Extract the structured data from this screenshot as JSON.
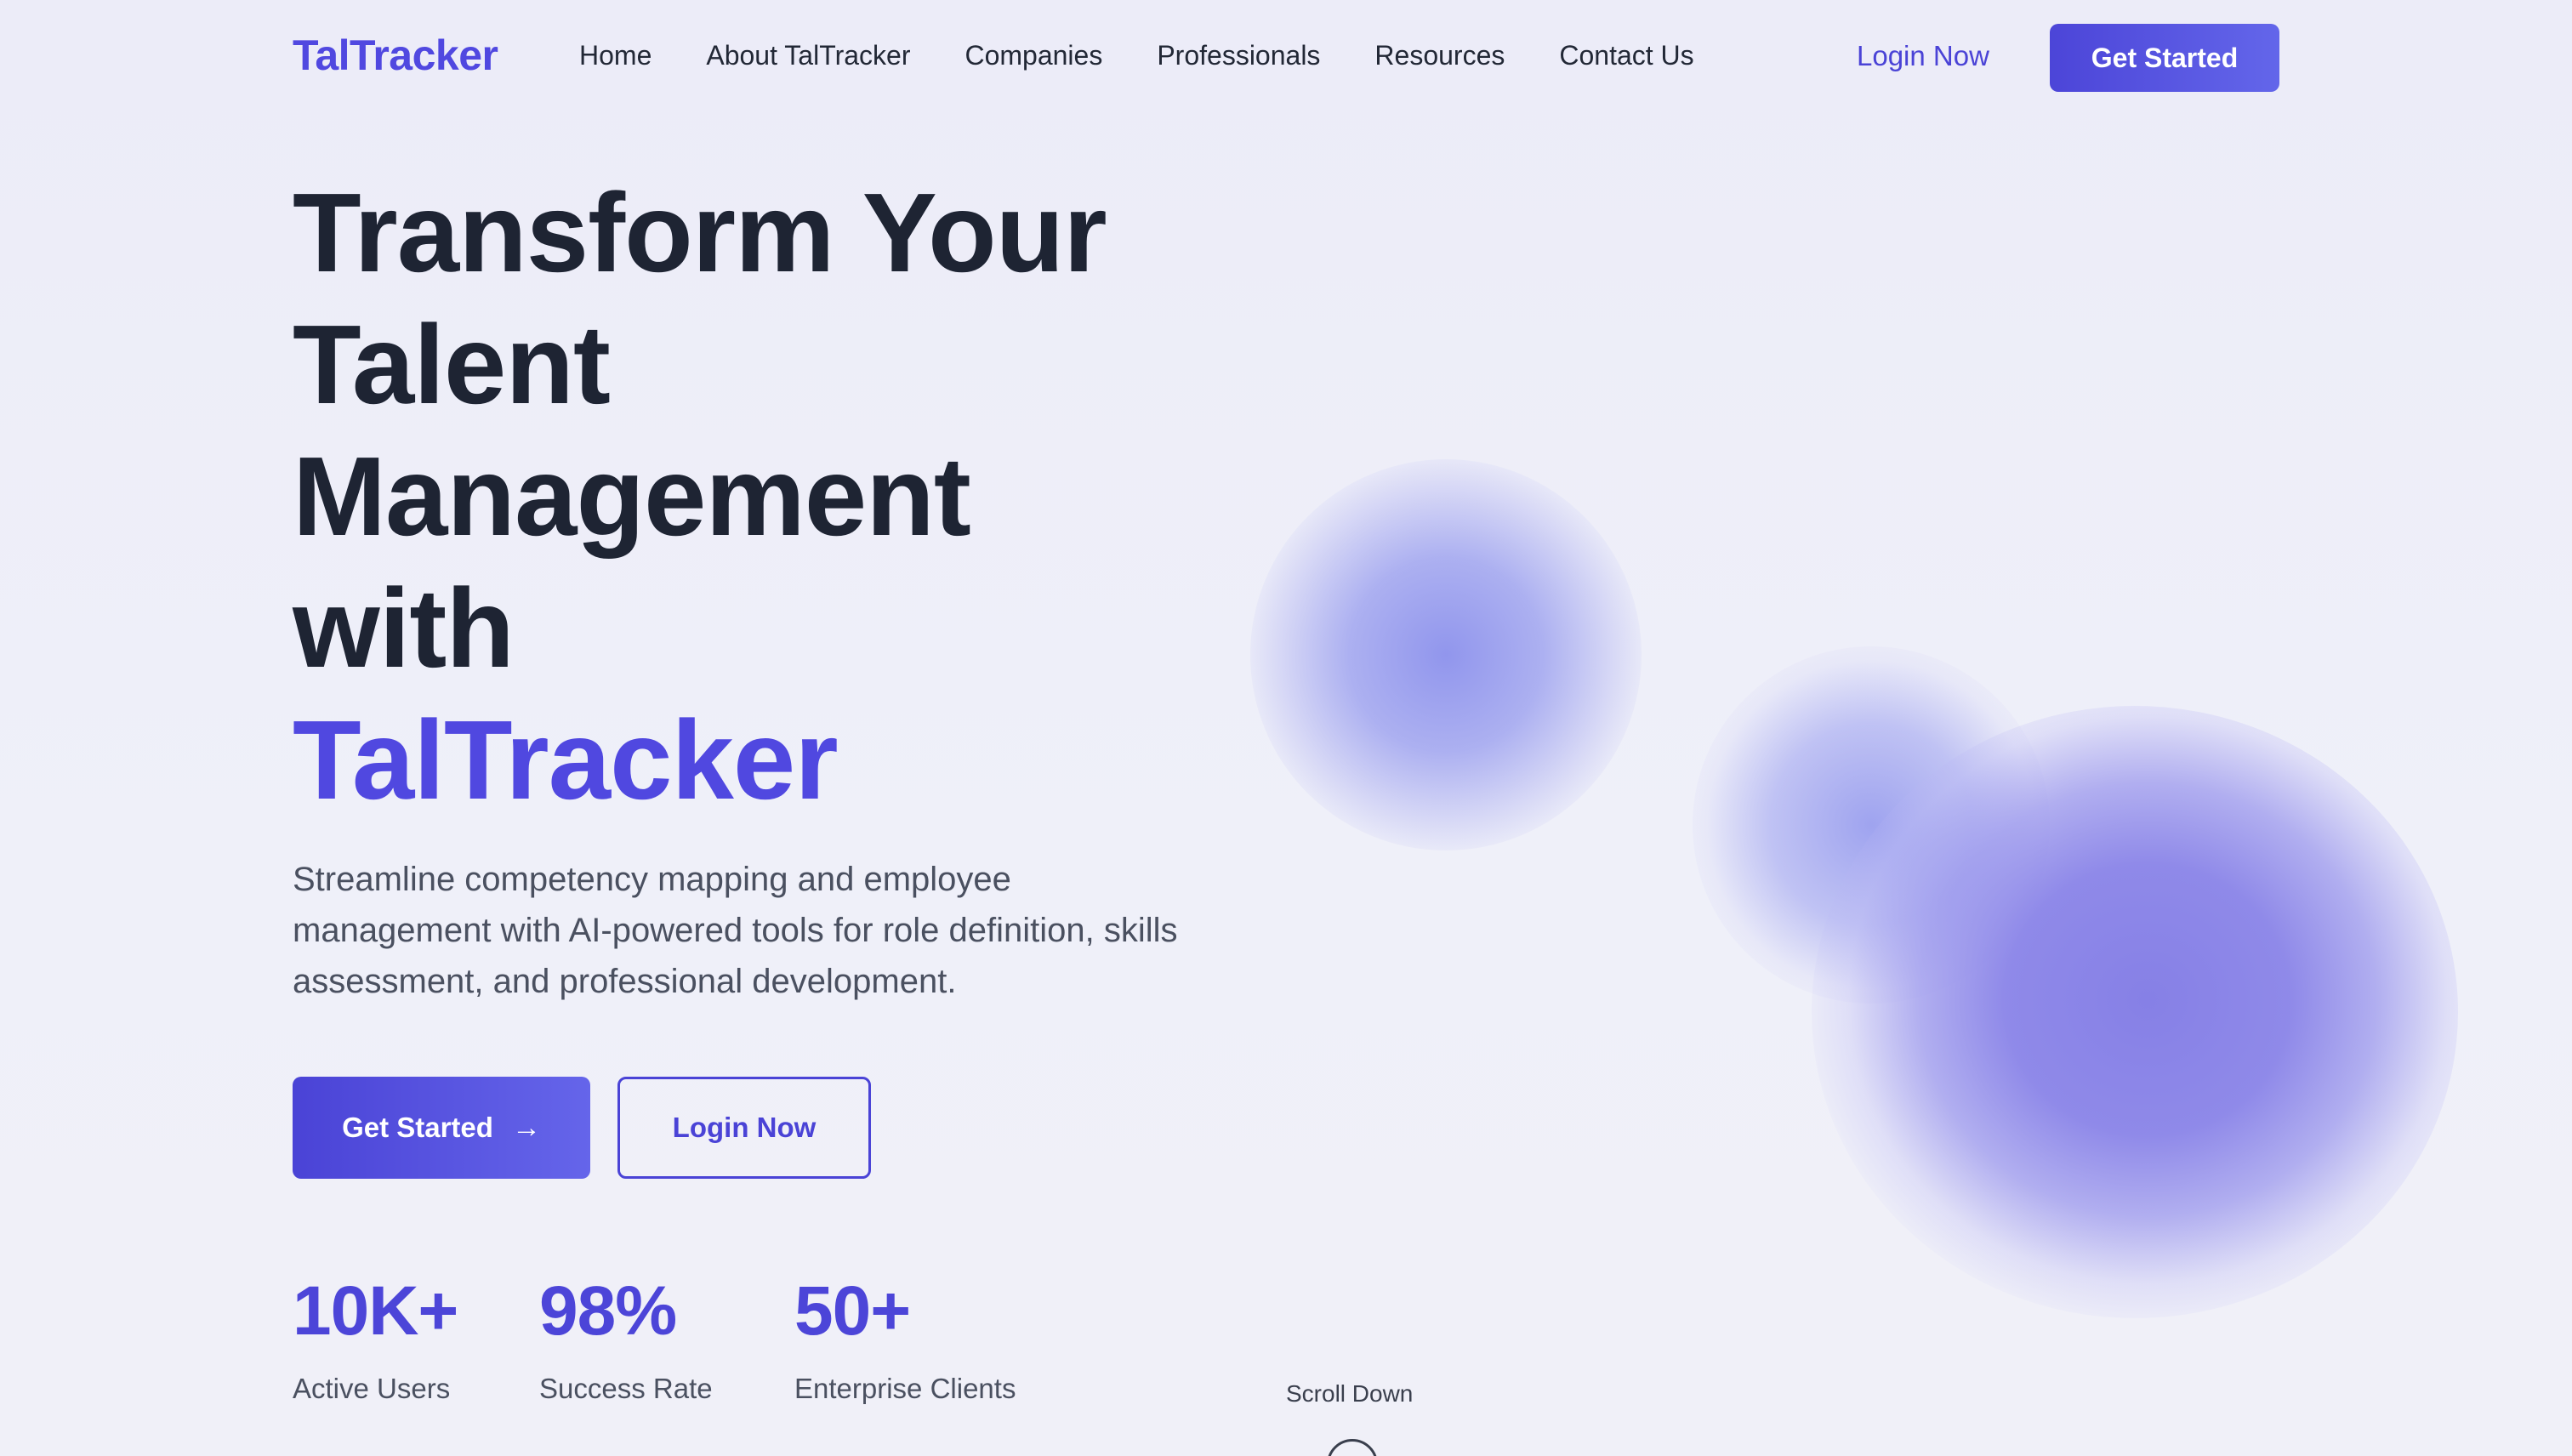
{
  "nav": {
    "logo": "TalTracker",
    "items": [
      {
        "label": "Home"
      },
      {
        "label": "About TalTracker"
      },
      {
        "label": "Companies"
      },
      {
        "label": "Professionals"
      },
      {
        "label": "Resources"
      },
      {
        "label": "Contact Us"
      }
    ],
    "login_label": "Login Now",
    "cta_label": "Get Started"
  },
  "hero": {
    "headline_lines": [
      "Transform Your",
      "Talent",
      "Management",
      "with"
    ],
    "headline_brand": "TalTracker",
    "subtitle": "Streamline competency mapping and employee management with AI-powered tools for role definition, skills assessment, and professional development.",
    "primary_button": "Get Started",
    "secondary_button": "Login Now"
  },
  "stats": [
    {
      "value": "10K+",
      "label": "Active Users"
    },
    {
      "value": "98%",
      "label": "Success Rate"
    },
    {
      "value": "50+",
      "label": "Enterprise Clients"
    }
  ],
  "scroll": {
    "label": "Scroll Down"
  },
  "colors": {
    "accent": "#5048e0",
    "text": "#1e2433",
    "background": "#eeeef9"
  }
}
